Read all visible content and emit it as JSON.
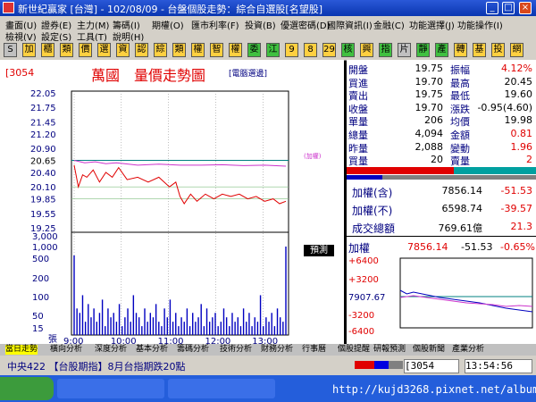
{
  "window": {
    "title": "新世紀贏家 [台灣] - 102/08/09 - 台盤個股走勢：綜合自選股[名望股]",
    "controls": [
      "_",
      "□",
      "×"
    ]
  },
  "menu": {
    "row1": [
      "畫面(U)",
      "證券(E)",
      "主力(M)",
      "籌碼(I)",
      "期權(O)",
      "匯市利率(F)",
      "投資(B)",
      "優選密碼(D)",
      "國際資訊(I)",
      "金融(C)",
      "功能選擇(J)",
      "功能操作(I)"
    ],
    "row2": [
      "檢視(V)",
      "設定(S)",
      "工具(T)",
      "說明(H)"
    ]
  },
  "toolbar": {
    "buttons": [
      "S",
      "加",
      "櫃",
      "類",
      "價",
      "選",
      "資",
      "認",
      "綜",
      "類",
      "權",
      "智",
      "權",
      "委",
      "江",
      "9",
      "8",
      "29",
      "核",
      "興",
      "指",
      "片",
      "靜",
      "產",
      "轉",
      "基",
      "投",
      "網"
    ]
  },
  "chart": {
    "stock_code": "[3054",
    "title": "萬國　量價走勢圖",
    "mode_label": "[電腦選邊]",
    "price_ticks": [
      "22.05",
      "21.75",
      "21.45",
      "21.20",
      "20.90",
      "20.65",
      "20.40",
      "20.10",
      "19.85",
      "19.55",
      "19.25"
    ],
    "volume_ticks": [
      "3,000",
      "1,000",
      "500",
      "200",
      "100",
      "50",
      "15",
      "張"
    ],
    "time_ticks": [
      "9:00",
      "10:00",
      "11:00",
      "12:00",
      "13:00"
    ],
    "overlay_label": "(加權)",
    "forecast_button": "預測",
    "chart_data": {
      "type": "line",
      "x_range": [
        "9:00",
        "13:30"
      ],
      "ylim": [
        19.25,
        22.05
      ],
      "reference_price": 20.65,
      "series": [
        {
          "name": "價",
          "color": "#e00000",
          "points": [
            [
              0,
              20.55
            ],
            [
              0.02,
              20.1
            ],
            [
              0.04,
              20.35
            ],
            [
              0.06,
              20.3
            ],
            [
              0.09,
              20.45
            ],
            [
              0.12,
              20.2
            ],
            [
              0.15,
              20.4
            ],
            [
              0.18,
              20.3
            ],
            [
              0.21,
              20.5
            ],
            [
              0.25,
              20.25
            ],
            [
              0.3,
              20.3
            ],
            [
              0.35,
              20.2
            ],
            [
              0.4,
              20.3
            ],
            [
              0.45,
              20.1
            ],
            [
              0.48,
              20.2
            ],
            [
              0.5,
              19.9
            ],
            [
              0.52,
              19.75
            ],
            [
              0.55,
              19.95
            ],
            [
              0.58,
              19.8
            ],
            [
              0.62,
              19.95
            ],
            [
              0.66,
              19.85
            ],
            [
              0.7,
              19.95
            ],
            [
              0.74,
              19.9
            ],
            [
              0.78,
              19.95
            ],
            [
              0.82,
              19.85
            ],
            [
              0.86,
              19.9
            ],
            [
              0.9,
              19.8
            ],
            [
              0.94,
              19.85
            ],
            [
              0.97,
              19.75
            ],
            [
              1,
              19.8
            ]
          ]
        },
        {
          "name": "加權",
          "color": "#cc33cc",
          "points": [
            [
              0,
              20.65
            ],
            [
              0.05,
              20.6
            ],
            [
              0.1,
              20.62
            ],
            [
              0.15,
              20.58
            ],
            [
              0.2,
              20.6
            ],
            [
              0.3,
              20.55
            ],
            [
              0.4,
              20.57
            ],
            [
              0.5,
              20.55
            ],
            [
              0.6,
              20.55
            ],
            [
              0.7,
              20.56
            ],
            [
              0.8,
              20.54
            ],
            [
              0.9,
              20.55
            ],
            [
              1,
              20.53
            ]
          ]
        }
      ],
      "volume": [
        18,
        6,
        5,
        9,
        3,
        7,
        4,
        6,
        3,
        5,
        8,
        2,
        6,
        4,
        5,
        3,
        7,
        2,
        4,
        6,
        3,
        9,
        5,
        4,
        2,
        6,
        3,
        5,
        4,
        7,
        3,
        2,
        6,
        4,
        8,
        3,
        5,
        2,
        4,
        3,
        6,
        2,
        5,
        3,
        4,
        7,
        2,
        6,
        3,
        4,
        5,
        2,
        3,
        6,
        4,
        2,
        5,
        3,
        4,
        2,
        6,
        3,
        5,
        2,
        4,
        3,
        9,
        2,
        4,
        3,
        5,
        2,
        6,
        4,
        3,
        20
      ]
    }
  },
  "quote": {
    "rows": [
      {
        "l1": "開盤",
        "v1": "19.75",
        "l2": "振幅",
        "v2": "4.12%",
        "c2": "red"
      },
      {
        "l1": "買進",
        "v1": "19.70",
        "l2": "最高",
        "v2": "20.45",
        "c2": "blk"
      },
      {
        "l1": "賣出",
        "v1": "19.75",
        "l2": "最低",
        "v2": "19.60",
        "c2": "blk"
      },
      {
        "l1": "收盤",
        "v1": "19.70",
        "l2": "漲跌",
        "v2": "-0.95(4.60)",
        "c2": "blk"
      },
      {
        "l1": "單量",
        "v1": "206",
        "l2": "均價",
        "v2": "19.98",
        "c2": "blk"
      },
      {
        "l1": "總量",
        "v1": "4,094",
        "l2": "金額",
        "v2": "0.81",
        "c2": "red"
      },
      {
        "l1": "昨量",
        "v1": "2,088",
        "l2": "變動",
        "v2": "1.96",
        "c2": "red"
      },
      {
        "l1": "買量",
        "v1": "20",
        "l2": "賣量",
        "v2": "2",
        "c2": "red"
      }
    ]
  },
  "index": {
    "rows": [
      {
        "label": "加權(含)",
        "value": "7856.14",
        "change": "-51.53"
      },
      {
        "label": "加權(不)",
        "value": "6598.74",
        "change": "-39.57"
      },
      {
        "label": "成交總額",
        "value": "769.61億",
        "change": "21.3"
      }
    ]
  },
  "minichart": {
    "label": "加權",
    "value": "7856.14",
    "change": "-51.53",
    "pct": "-0.65%",
    "ticks": [
      "+6400",
      "+3200",
      "7907.67",
      "-3200",
      "-6400"
    ]
  },
  "tabs": [
    "當日走勢",
    "橫向分析",
    "深度分析",
    "基本分析",
    "籌碼分析",
    "技術分析",
    "財務分析",
    "行事曆",
    "個股提醒",
    "研報預測",
    "個股新聞",
    "產業分析"
  ],
  "status": {
    "left": "中央422 【台股期指】8月台指期跌20點",
    "code": "[3054",
    "time": "13:54:56"
  },
  "taskbar": {
    "watermark": "http://kujd3268.pixnet.net/album"
  }
}
